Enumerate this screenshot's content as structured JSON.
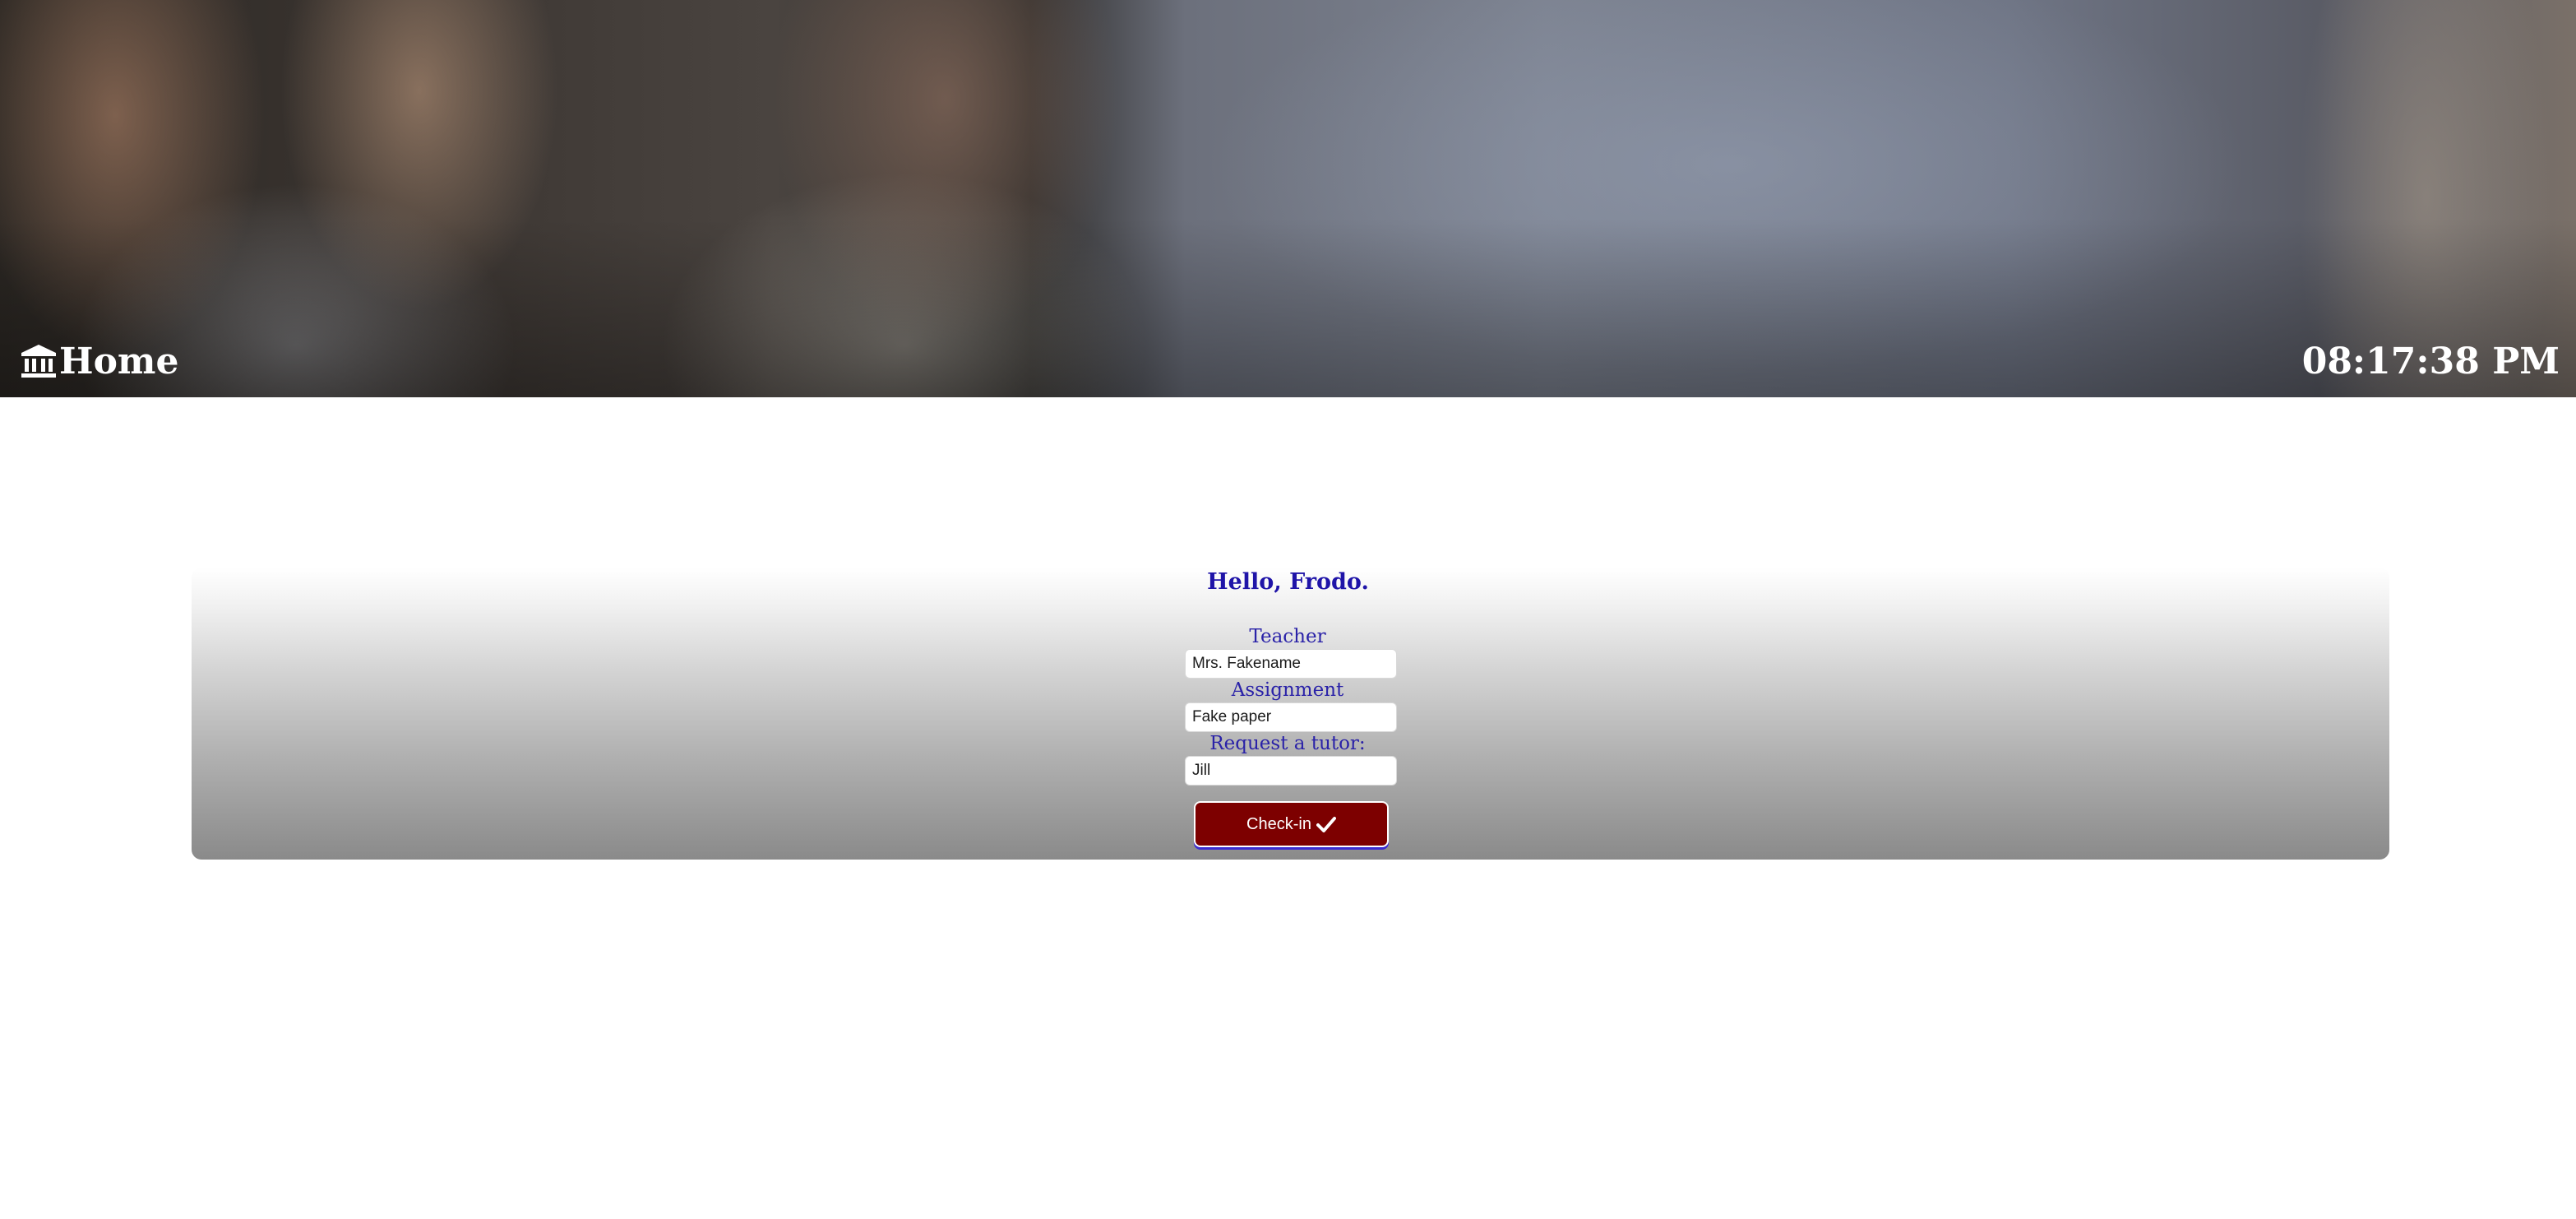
{
  "header": {
    "brand_label": "Home",
    "brand_icon": "institution-icon",
    "clock_time": "08:17:38 PM"
  },
  "form": {
    "greeting": "Hello, Frodo.",
    "teacher": {
      "label": "Teacher",
      "value": "Mrs. Fakename"
    },
    "assignment": {
      "label": "Assignment",
      "value": "Fake paper"
    },
    "tutor": {
      "label": "Request a tutor:",
      "value": "Jill"
    },
    "submit_label": "Check-in",
    "submit_icon": "check-icon"
  },
  "colors": {
    "heading_text": "#1f14a8",
    "button_bg": "#7d0000",
    "button_shadow": "#3b2bd0"
  }
}
